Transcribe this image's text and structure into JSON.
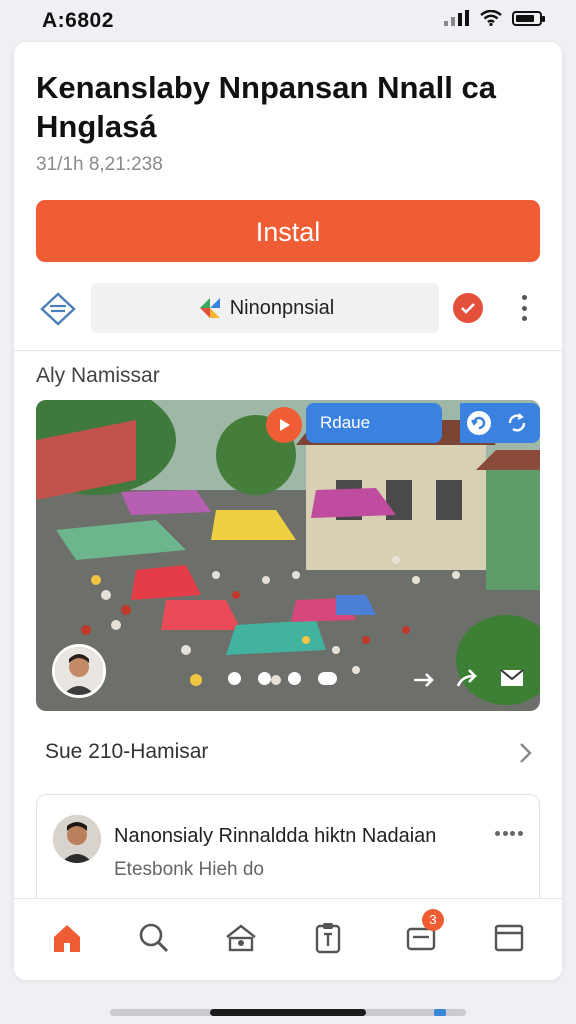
{
  "status_bar": {
    "time": "A:6802",
    "battery_level": 0.8
  },
  "app": {
    "title": "Kenanslaby Nnpansan Nnall ca Hnglasá",
    "meta": "31/1h 8,21:238",
    "install_label": "Instal",
    "source_name": "Ninonpnsial",
    "accent_color": "#ef5d35"
  },
  "section": {
    "label": "Aly Namissar"
  },
  "media": {
    "pill_label": "Rdaue",
    "dot_count": 4
  },
  "related": {
    "label": "Sue 210-Hamisar"
  },
  "comment": {
    "title": "Nanonsialy Rinnaldda hiktn Nadaian",
    "subtitle": "Etesbonk Hieh do"
  },
  "nav": {
    "items": [
      {
        "icon": "home-icon",
        "active": true
      },
      {
        "icon": "search-icon"
      },
      {
        "icon": "store-icon"
      },
      {
        "icon": "clipboard-icon"
      },
      {
        "icon": "inbox-icon",
        "badge": "3"
      },
      {
        "icon": "window-icon"
      }
    ],
    "badge": "3"
  },
  "colors": {
    "accent": "#ef5d35",
    "blue": "#3b82e0"
  }
}
